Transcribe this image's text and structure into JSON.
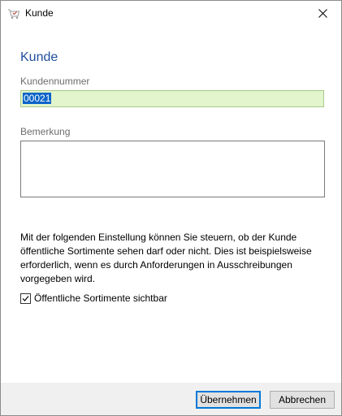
{
  "window": {
    "title": "Kunde",
    "icon": "shopping-cart-icon"
  },
  "form": {
    "heading": "Kunde",
    "kundennummer_label": "Kundennummer",
    "kundennummer_value": "00021",
    "bemerkung_label": "Bemerkung",
    "bemerkung_value": "",
    "description": "Mit der folgenden Einstellung können Sie steuern, ob der Kunde öffentliche Sortimente sehen darf oder nicht. Dies ist beispielsweise erforderlich, wenn es durch Anforderungen in Ausschreibungen vorgegeben wird.",
    "checkbox_label": "Öffentliche Sortimente sichtbar",
    "checkbox_checked": true
  },
  "buttons": {
    "ok_label": "Übernehmen",
    "cancel_label": "Abbrechen"
  },
  "colors": {
    "heading": "#1f4e9c",
    "input_bg": "#e2f5cc",
    "selection": "#0a64c8",
    "default_button_border": "#0078d7"
  }
}
